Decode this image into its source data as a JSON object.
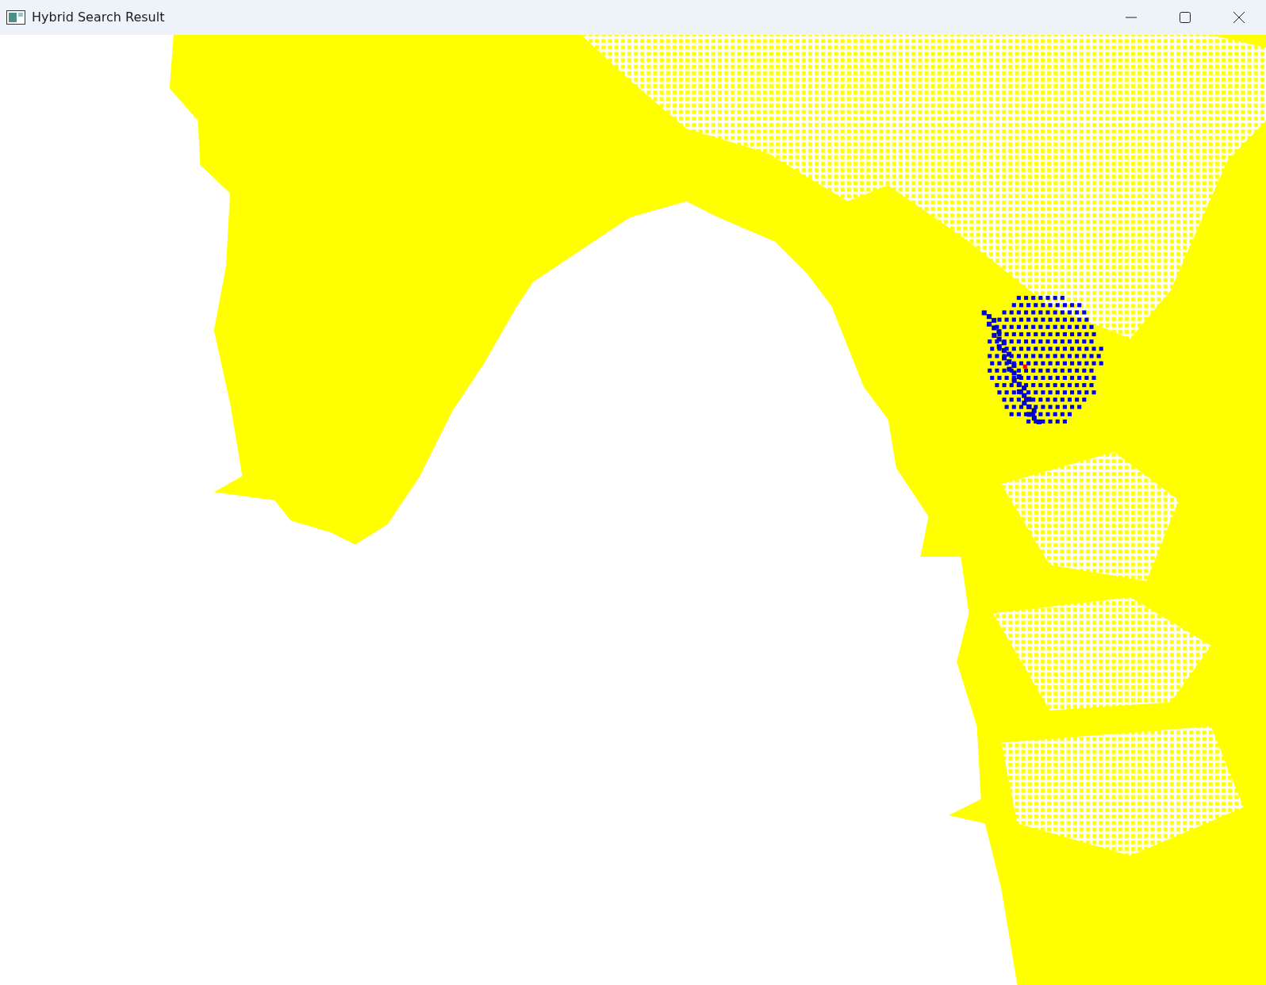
{
  "window": {
    "title": "Hybrid Search Result"
  }
}
